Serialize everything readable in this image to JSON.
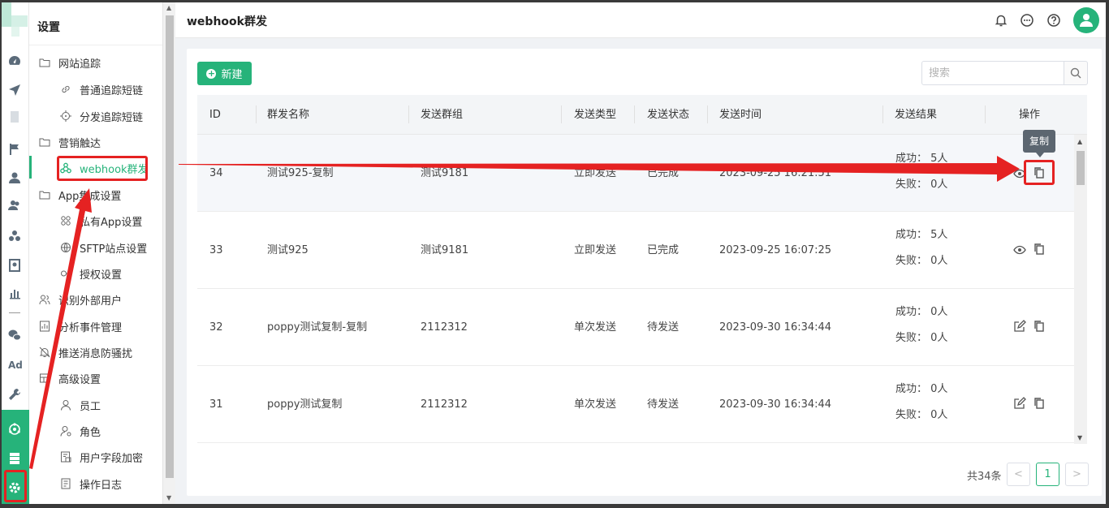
{
  "header": {
    "title": "webhook群发",
    "icons": [
      "bell-icon",
      "chat-icon",
      "help-icon",
      "user-avatar-icon"
    ]
  },
  "sidebar": {
    "title": "设置",
    "items": [
      {
        "label": "网站追踪",
        "level": 1,
        "icon": "folder-icon"
      },
      {
        "label": "普通追踪短链",
        "level": 2,
        "icon": "link-icon"
      },
      {
        "label": "分发追踪短链",
        "level": 2,
        "icon": "crosshair-icon"
      },
      {
        "label": "营销触达",
        "level": 1,
        "icon": "folder-icon"
      },
      {
        "label": "webhook群发",
        "level": 2,
        "icon": "webhook-icon",
        "active": true
      },
      {
        "label": "App集成设置",
        "level": 1,
        "icon": "folder-icon"
      },
      {
        "label": "私有App设置",
        "level": 2,
        "icon": "apps-icon"
      },
      {
        "label": "SFTP站点设置",
        "level": 2,
        "icon": "globe-icon"
      },
      {
        "label": "授权设置",
        "level": 2,
        "icon": "key-icon"
      },
      {
        "label": "识别外部用户",
        "level": 1,
        "icon": "users-icon"
      },
      {
        "label": "分析事件管理",
        "level": 1,
        "icon": "chart-doc-icon"
      },
      {
        "label": "推送消息防骚扰",
        "level": 1,
        "icon": "bell-off-icon"
      },
      {
        "label": "高级设置",
        "level": 1,
        "icon": "grid-icon"
      },
      {
        "label": "员工",
        "level": 2,
        "icon": "user-icon"
      },
      {
        "label": "角色",
        "level": 2,
        "icon": "user-settings-icon"
      },
      {
        "label": "用户字段加密",
        "level": 2,
        "icon": "lock-doc-icon"
      },
      {
        "label": "操作日志",
        "level": 2,
        "icon": "log-icon"
      }
    ]
  },
  "rail": {
    "icons": [
      "dashboard-icon",
      "send-icon",
      "flag-icon",
      "person-icon",
      "people-icon",
      "group-icon",
      "badge-icon",
      "bar-chart-icon",
      "wechat-icon",
      "ad-icon",
      "wrench-icon",
      "integration-icon",
      "server-icon",
      "settings-icon"
    ],
    "ad_label": "Ad"
  },
  "toolbar": {
    "new_label": "新建",
    "search_placeholder": "搜索"
  },
  "table": {
    "columns": [
      "ID",
      "群发名称",
      "发送群组",
      "发送类型",
      "发送状态",
      "发送时间",
      "发送结果",
      "操作"
    ],
    "rows": [
      {
        "id": "34",
        "name": "测试925-复制",
        "group": "测试9181",
        "type": "立即发送",
        "status": "已完成",
        "time": "2023-09-25 16:21:51",
        "success": "成功： 5人",
        "fail": "失败： 0人",
        "first_action": "view"
      },
      {
        "id": "33",
        "name": "测试925",
        "group": "测试9181",
        "type": "立即发送",
        "status": "已完成",
        "time": "2023-09-25 16:07:25",
        "success": "成功： 5人",
        "fail": "失败： 0人",
        "first_action": "view"
      },
      {
        "id": "32",
        "name": "poppy测试复制-复制",
        "group": "2112312",
        "type": "单次发送",
        "status": "待发送",
        "time": "2023-09-30 16:34:44",
        "success": "成功： 0人",
        "fail": "失败： 0人",
        "first_action": "edit"
      },
      {
        "id": "31",
        "name": "poppy测试复制",
        "group": "2112312",
        "type": "单次发送",
        "status": "待发送",
        "time": "2023-09-30 16:34:44",
        "success": "成功： 0人",
        "fail": "失败： 0人",
        "first_action": "edit"
      }
    ],
    "tooltip": "复制"
  },
  "pagination": {
    "total": "共34条",
    "current": "1",
    "prev": "<",
    "next": ">"
  },
  "colors": {
    "accent": "#26b37a",
    "annotation": "#e52222"
  }
}
